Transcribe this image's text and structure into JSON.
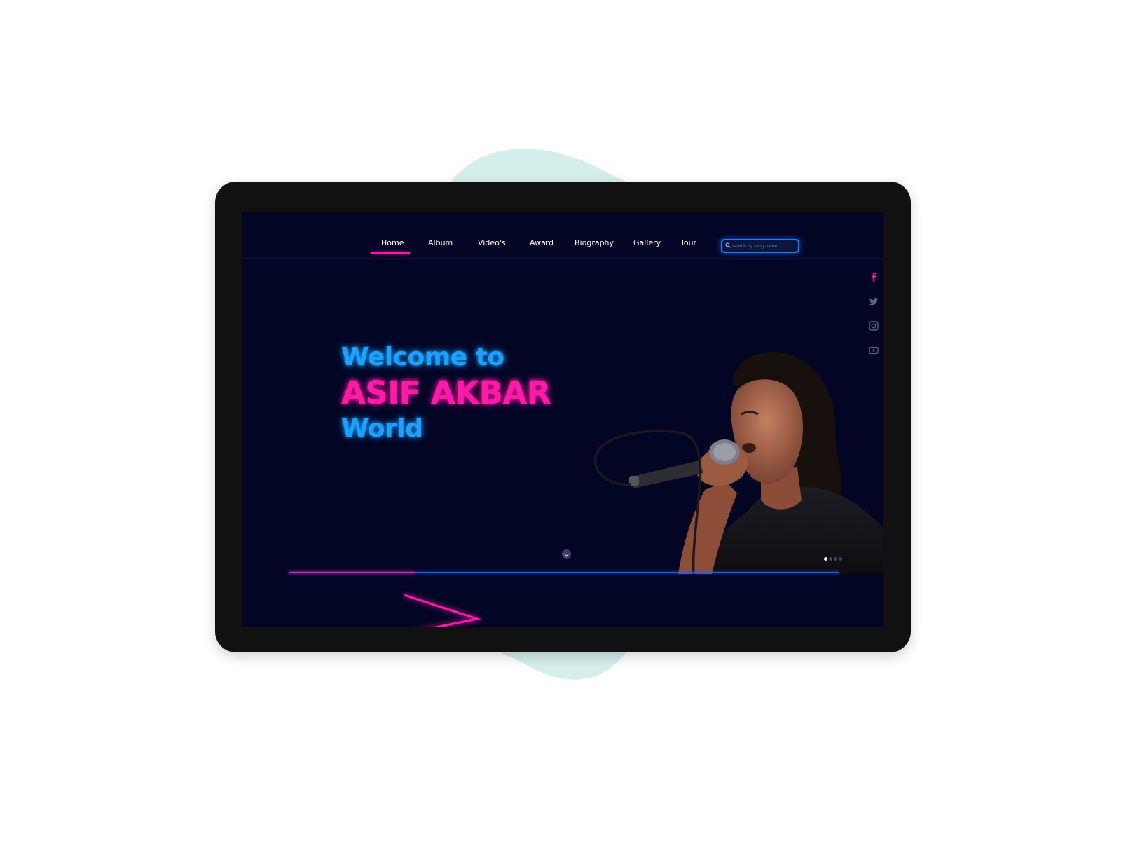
{
  "colors": {
    "background": "#ffffff",
    "blob": "#d4eeeb",
    "device_frame": "#111111",
    "screen_bg": "#020624",
    "neon_blue": "#1da1ff",
    "neon_pink": "#ff1aa8"
  },
  "nav": {
    "items": [
      {
        "label": "Home",
        "active": true
      },
      {
        "label": "Album"
      },
      {
        "label": "Video's"
      },
      {
        "label": "Award"
      },
      {
        "label": "Biography"
      },
      {
        "label": "Gallery"
      },
      {
        "label": "Tour"
      }
    ],
    "search": {
      "placeholder": "search by song name",
      "icon": "search-icon"
    }
  },
  "hero": {
    "line1": "Welcome to",
    "line2": "ASIF AKBAR",
    "line3": "World"
  },
  "social": [
    "facebook-icon",
    "twitter-icon",
    "instagram-icon",
    "youtube-icon"
  ],
  "slider": {
    "total_slides": 4,
    "active_slide": 1,
    "progress_fraction": 0.23
  }
}
